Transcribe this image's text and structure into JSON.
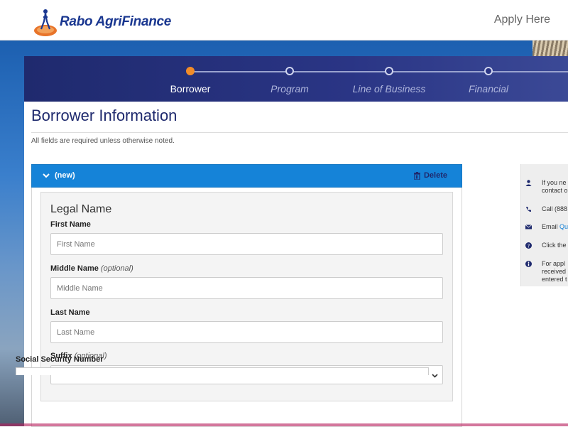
{
  "header": {
    "logo_text": "Rabo AgriFinance",
    "apply_link": "Apply Here"
  },
  "steps": [
    {
      "label": "Borrower",
      "active": true
    },
    {
      "label": "Program",
      "active": false
    },
    {
      "label": "Line of Business",
      "active": false
    },
    {
      "label": "Financial",
      "active": false
    }
  ],
  "page": {
    "title": "Borrower Information",
    "required_note": "All fields are required unless otherwise noted."
  },
  "accordion": {
    "title": "(new)",
    "delete_label": "Delete",
    "header_color": "#1583d8"
  },
  "legal_name": {
    "section_title": "Legal Name",
    "first_name": {
      "label": "First Name",
      "placeholder": "First Name",
      "value": ""
    },
    "middle_name": {
      "label": "Middle Name",
      "optional": "(optional)",
      "placeholder": "Middle Name",
      "value": ""
    },
    "last_name": {
      "label": "Last Name",
      "placeholder": "Last Name",
      "value": ""
    },
    "suffix": {
      "label": "Suffix",
      "optional": "(optional)",
      "selected": ""
    }
  },
  "ssn": {
    "label": "Social Security Number"
  },
  "help": {
    "items": [
      {
        "icon": "user-icon",
        "line1": "If you ne",
        "line2": "contact o"
      },
      {
        "icon": "phone-icon",
        "line1": "Call (888"
      },
      {
        "icon": "envelope-icon",
        "line1": "Email ",
        "link": "Qu"
      },
      {
        "icon": "question-icon",
        "line1": "Click the"
      },
      {
        "icon": "info-icon",
        "line1": "For appl",
        "line2": "received",
        "line3": "entered t"
      }
    ]
  },
  "colors": {
    "brand_navy": "#1f2a6e",
    "active_step": "#f28c28",
    "accordion_blue": "#1583d8"
  }
}
